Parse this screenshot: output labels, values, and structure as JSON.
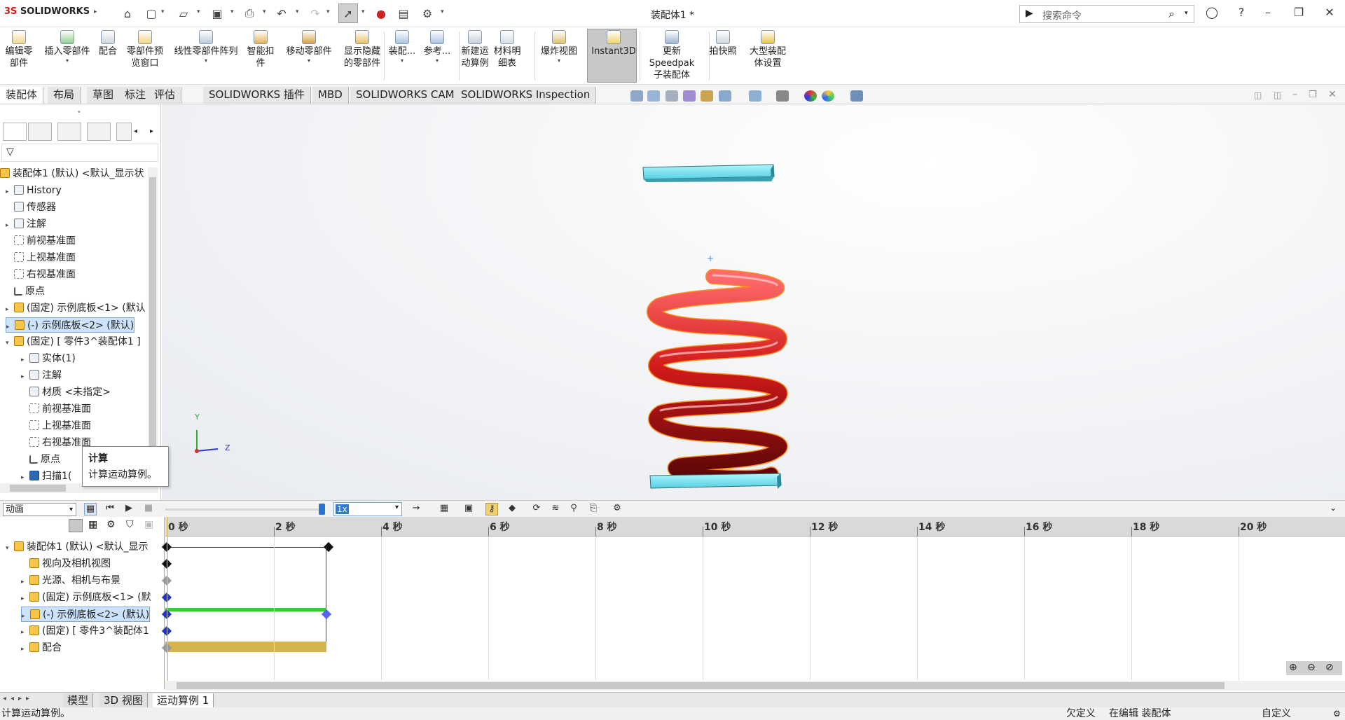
{
  "app": {
    "logo": "SOLIDWORKS",
    "doc_title": "装配体1 *"
  },
  "search": {
    "placeholder": "搜索命令"
  },
  "commands": [
    {
      "l1": "编辑零",
      "l2": "部件",
      "dd": ""
    },
    {
      "l1": "插入零部件",
      "l2": "",
      "dd": "▾"
    },
    {
      "l1": "配合",
      "l2": "",
      "dd": ""
    },
    {
      "l1": "零部件预",
      "l2": "览窗口",
      "dd": ""
    },
    {
      "l1": "线性零部件阵列",
      "l2": "",
      "dd": "▾"
    },
    {
      "l1": "智能扣",
      "l2": "件",
      "dd": ""
    },
    {
      "l1": "移动零部件",
      "l2": "",
      "dd": "▾"
    },
    {
      "l1": "显示隐藏",
      "l2": "的零部件",
      "dd": ""
    },
    {
      "l1": "装配...",
      "l2": "",
      "dd": "▾"
    },
    {
      "l1": "参考...",
      "l2": "",
      "dd": "▾"
    },
    {
      "l1": "新建运",
      "l2": "动算例",
      "dd": ""
    },
    {
      "l1": "材料明",
      "l2": "细表",
      "dd": ""
    },
    {
      "l1": "爆炸视图",
      "l2": "",
      "dd": "▾"
    },
    {
      "l1": "Instant3D",
      "l2": "",
      "dd": ""
    },
    {
      "l1": "更新 Speedpak",
      "l2": "子装配体",
      "dd": ""
    },
    {
      "l1": "拍快照",
      "l2": "",
      "dd": ""
    },
    {
      "l1": "大型装配",
      "l2": "体设置",
      "dd": ""
    }
  ],
  "tabs": [
    "装配体",
    "布局",
    "草图",
    "标注",
    "评估",
    "SOLIDWORKS 插件",
    "MBD",
    "SOLIDWORKS CAM",
    "SOLIDWORKS Inspection"
  ],
  "tree": [
    {
      "label": "装配体1 (默认) <默认_显示状",
      "indent": 0,
      "arrow": "",
      "icon": "y"
    },
    {
      "label": "History",
      "indent": 1,
      "arrow": "▸",
      "icon": ""
    },
    {
      "label": "传感器",
      "indent": 1,
      "arrow": "",
      "icon": ""
    },
    {
      "label": "注解",
      "indent": 1,
      "arrow": "▸",
      "icon": ""
    },
    {
      "label": "前视基准面",
      "indent": 1,
      "arrow": "",
      "icon": "p"
    },
    {
      "label": "上视基准面",
      "indent": 1,
      "arrow": "",
      "icon": "p"
    },
    {
      "label": "右视基准面",
      "indent": 1,
      "arrow": "",
      "icon": "p"
    },
    {
      "label": "原点",
      "indent": 1,
      "arrow": "",
      "icon": "o"
    },
    {
      "label": "(固定) 示例底板<1> (默认",
      "indent": 1,
      "arrow": "▸",
      "icon": "y"
    },
    {
      "label": "(-) 示例底板<2> (默认)",
      "indent": 1,
      "arrow": "▸",
      "icon": "y",
      "selected": true
    },
    {
      "label": "(固定) [ 零件3^装配体1 ]",
      "indent": 1,
      "arrow": "▾",
      "icon": "y"
    },
    {
      "label": "实体(1)",
      "indent": 2,
      "arrow": "▸",
      "icon": ""
    },
    {
      "label": "注解",
      "indent": 2,
      "arrow": "▸",
      "icon": ""
    },
    {
      "label": "材质 <未指定>",
      "indent": 2,
      "arrow": "",
      "icon": ""
    },
    {
      "label": "前视基准面",
      "indent": 2,
      "arrow": "",
      "icon": "p"
    },
    {
      "label": "上视基准面",
      "indent": 2,
      "arrow": "",
      "icon": "p"
    },
    {
      "label": "右视基准面",
      "indent": 2,
      "arrow": "",
      "icon": "p"
    },
    {
      "label": "原点",
      "indent": 2,
      "arrow": "",
      "icon": "o"
    },
    {
      "label": "扫描1(",
      "indent": 2,
      "arrow": "▸",
      "icon": "b"
    }
  ],
  "tooltip": {
    "title": "计算",
    "desc": "计算运动算例。"
  },
  "motion": {
    "study_type": "动画",
    "speed": "1x"
  },
  "ruler": [
    "0 秒",
    "2 秒",
    "4 秒",
    "6 秒",
    "8 秒",
    "10 秒",
    "12 秒",
    "14 秒",
    "16 秒",
    "18 秒",
    "20 秒"
  ],
  "timeline_tree": [
    {
      "label": "装配体1 (默认) <默认_显示",
      "arrow": "▾",
      "indent": 0
    },
    {
      "label": "视向及相机视图",
      "arrow": "",
      "indent": 1
    },
    {
      "label": "光源、相机与布景",
      "arrow": "▸",
      "indent": 1
    },
    {
      "label": "(固定) 示例底板<1> (默",
      "arrow": "▸",
      "indent": 1
    },
    {
      "label": "(-) 示例底板<2> (默认)",
      "arrow": "▸",
      "indent": 1,
      "selected": true
    },
    {
      "label": "(固定) [ 零件3^装配体1",
      "arrow": "▸",
      "indent": 1
    },
    {
      "label": "配合",
      "arrow": "▸",
      "indent": 1
    }
  ],
  "bottom_tabs": [
    "模型",
    "3D 视图",
    "运动算例 1"
  ],
  "status": {
    "left": "计算运动算例。",
    "mid1": "欠定义",
    "mid2": "在编辑 装配体",
    "right": "自定义"
  },
  "triad": {
    "y": "Y",
    "z": "Z"
  },
  "colors": {
    "spring": "#d21a1a",
    "plate": "#6fe3f2",
    "track_green": "#33cc33",
    "track_gold": "#d4b44c",
    "selection": "#cde3fb"
  }
}
